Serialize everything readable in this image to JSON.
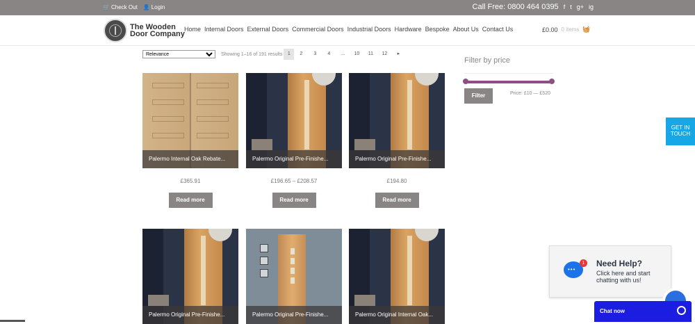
{
  "topbar": {
    "checkout": "Check Out",
    "login": "Login",
    "phone": "Call Free: 0800 464 0395",
    "social": [
      "f",
      "t",
      "g+",
      "ig"
    ]
  },
  "logo": {
    "line1": "The Wooden",
    "line2": "Door Company"
  },
  "nav": [
    "Home",
    "Internal Doors",
    "External Doors",
    "Commercial Doors",
    "Industrial Doors",
    "Hardware",
    "Bespoke",
    "About Us",
    "Contact Us"
  ],
  "cart": {
    "total": "£0.00",
    "items": "0 items"
  },
  "toolbar": {
    "sort_selected": "Relevance",
    "result_count": "Showing 1–16 of 191 results",
    "pages": [
      "1",
      "2",
      "3",
      "4",
      "…",
      "10",
      "11",
      "12",
      "▸"
    ]
  },
  "products": [
    {
      "title": "Palermo Internal Oak Rebate...",
      "price": "£365.91",
      "button": "Read more"
    },
    {
      "title": "Palermo Original Pre-Finishe...",
      "price": "£196.65 – £208.57",
      "button": "Read more"
    },
    {
      "title": "Palermo Original Pre-Finishe...",
      "price": "£194.80",
      "button": "Read more"
    },
    {
      "title": "Palermo Original Pre-Finishe...",
      "price": "",
      "button": ""
    },
    {
      "title": "Palermo Original Pre-Finishe...",
      "price": "",
      "button": ""
    },
    {
      "title": "Palermo Original Internal Oak...",
      "price": "",
      "button": ""
    }
  ],
  "filter": {
    "title": "Filter by price",
    "button": "Filter",
    "range": "Price: £10 — £520"
  },
  "get_in_touch": "GET IN TOUCH",
  "help": {
    "title": "Need Help?",
    "text": "Click here and start chatting with us!",
    "badge": "1"
  },
  "chat": {
    "label": "Chat now"
  }
}
